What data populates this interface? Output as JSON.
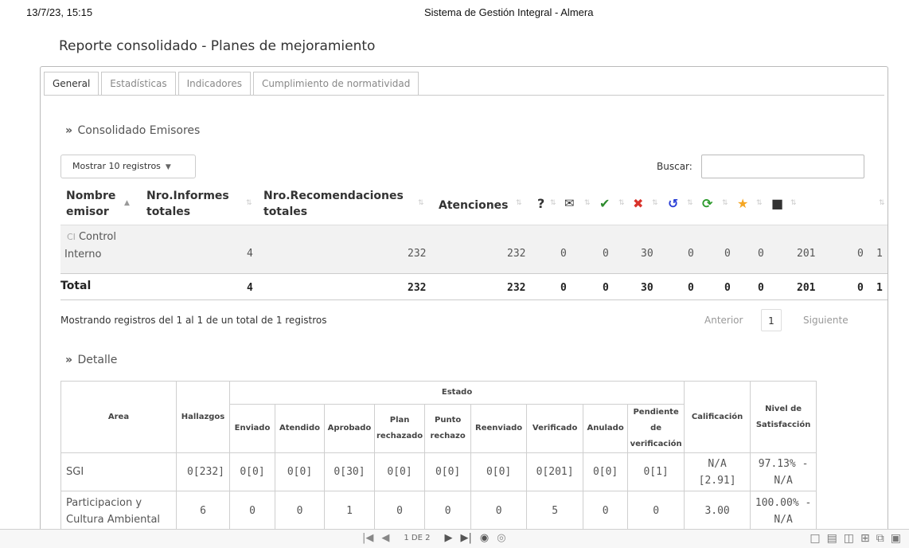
{
  "print_header": {
    "datetime": "13/7/23, 15:15",
    "system": "Sistema de Gestión Integral - Almera"
  },
  "page_title": "Reporte consolidado - Planes de mejoramiento",
  "tabs": [
    {
      "label": "General",
      "active": true
    },
    {
      "label": "Estadísticas",
      "active": false
    },
    {
      "label": "Indicadores",
      "active": false
    },
    {
      "label": "Cumplimiento de normatividad",
      "active": false
    }
  ],
  "consolidado": {
    "section_title": "Consolidado Emisores",
    "length_select": "Mostrar 10 registros",
    "search_label": "Buscar:",
    "search_value": "",
    "columns": {
      "nombre_l1": "Nombre",
      "nombre_l2": "emisor",
      "informes_l1": "Nro.Informes",
      "informes_l2": "totales",
      "recom_l1": "Nro.Recomendaciones",
      "recom_l2": "totales",
      "atenciones": "Atenciones"
    },
    "icons": [
      {
        "name": "question-icon",
        "glyph": "?",
        "color": "#222222"
      },
      {
        "name": "envelope-icon",
        "glyph": "✉",
        "color": "#222222"
      },
      {
        "name": "check-icon",
        "glyph": "✔",
        "color": "#2e8b2e"
      },
      {
        "name": "close-icon",
        "glyph": "✖",
        "color": "#d9332b"
      },
      {
        "name": "undo-icon",
        "glyph": "↺",
        "color": "#2a3fd6"
      },
      {
        "name": "refresh-icon",
        "glyph": "⟳",
        "color": "#2e9b2e"
      },
      {
        "name": "star-icon",
        "glyph": "★",
        "color": "#f5a623"
      },
      {
        "name": "square-icon",
        "glyph": "■",
        "color": "#222222"
      }
    ],
    "row": {
      "badge": "CI",
      "emisor": "Control Interno",
      "informes": "4",
      "recomendaciones": "232",
      "atenciones": "232",
      "question": "0",
      "envelope": "0",
      "check": "30",
      "close": "0",
      "undo": "0",
      "refresh": "0",
      "star": "201",
      "square": "0",
      "extra": "1"
    },
    "total": {
      "label": "Total",
      "informes": "4",
      "recomendaciones": "232",
      "atenciones": "232",
      "question": "0",
      "envelope": "0",
      "check": "30",
      "close": "0",
      "undo": "0",
      "refresh": "0",
      "star": "201",
      "square": "0",
      "extra": "1"
    },
    "info": "Mostrando registros del 1 al 1 de un total de 1 registros",
    "pager": {
      "prev": "Anterior",
      "page": "1",
      "next": "Siguiente"
    }
  },
  "detalle": {
    "section_title": "Detalle",
    "headers": {
      "area": "Area",
      "hallazgos": "Hallazgos",
      "estado": "Estado",
      "enviado": "Enviado",
      "atendido": "Atendido",
      "aprobado": "Aprobado",
      "plan_l1": "Plan",
      "plan_l2": "rechazado",
      "punto_l1": "Punto",
      "punto_l2": "rechazo",
      "reenviado": "Reenviado",
      "verificado": "Verificado",
      "anulado": "Anulado",
      "pend_l1": "Pendiente de",
      "pend_l2": "verificación",
      "calificacion": "Calificación",
      "nivel_l1": "Nivel de",
      "nivel_l2": "Satisfacción"
    },
    "rows": [
      {
        "area_l1": "SGI",
        "area_l2": "",
        "hallazgos": "0[232]",
        "enviado": "0[0]",
        "atendido": "0[0]",
        "aprobado": "0[30]",
        "plan": "0[0]",
        "punto": "0[0]",
        "reenviado": "0[0]",
        "verificado": "0[201]",
        "anulado": "0[0]",
        "pendiente": "0[1]",
        "calif_l1": "N/A",
        "calif_l2": "[2.91]",
        "nivel_l1": "97.13% -",
        "nivel_l2": "N/A"
      },
      {
        "area_l1": "Participacion y",
        "area_l2": "Cultura Ambiental",
        "hallazgos": "6",
        "enviado": "0",
        "atendido": "0",
        "aprobado": "1",
        "plan": "0",
        "punto": "0",
        "reenviado": "0",
        "verificado": "5",
        "anulado": "0",
        "pendiente": "0",
        "calif_l1": "3.00",
        "calif_l2": "",
        "nivel_l1": "100.00% -",
        "nivel_l2": "N/A"
      }
    ]
  },
  "pdf_toolbar": {
    "page_label": "1 DE 2"
  }
}
